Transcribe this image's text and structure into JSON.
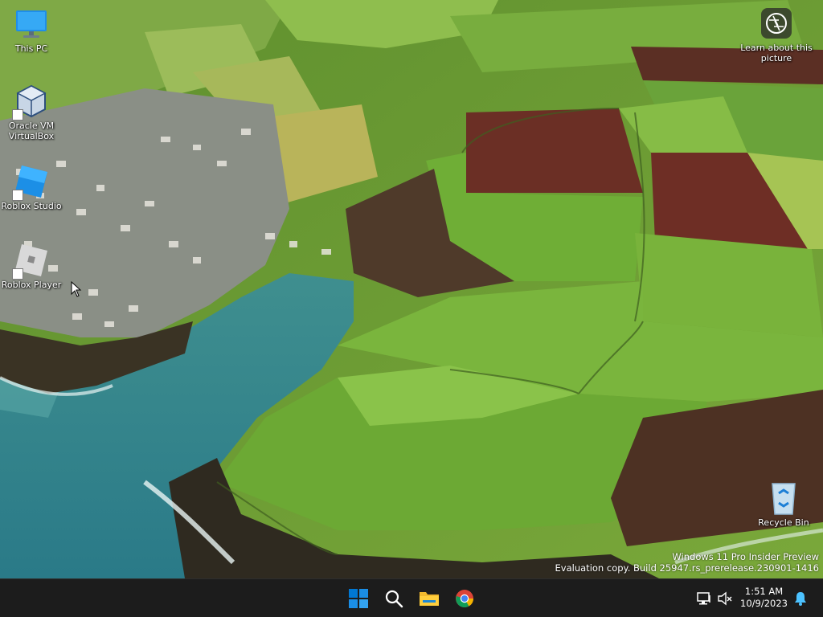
{
  "desktop": {
    "icons": [
      {
        "label": "This PC",
        "icon": "monitor-icon"
      },
      {
        "label": "Oracle VM VirtualBox",
        "icon": "virtualbox-icon"
      },
      {
        "label": "Roblox Studio",
        "icon": "roblox-studio-icon"
      },
      {
        "label": "Roblox Player",
        "icon": "roblox-player-icon"
      },
      {
        "label": "Recycle Bin",
        "icon": "recycle-bin-icon"
      }
    ],
    "learn_more": {
      "label": "Learn about this picture",
      "icon": "camera-icon"
    },
    "watermark": {
      "line1": "Windows 11 Pro Insider Preview",
      "line2": "Evaluation copy. Build 25947.rs_prerelease.230901-1416"
    }
  },
  "taskbar": {
    "pinned": [
      {
        "name": "Start",
        "icon": "windows-logo-icon"
      },
      {
        "name": "Search",
        "icon": "search-icon"
      },
      {
        "name": "File Explorer",
        "icon": "folder-icon"
      },
      {
        "name": "Google Chrome",
        "icon": "chrome-icon"
      }
    ],
    "tray": {
      "time": "1:51 AM",
      "date": "10/9/2023",
      "icons": [
        "network-icon",
        "volume-muted-icon",
        "notification-bell-icon"
      ]
    }
  },
  "colors": {
    "taskbar": "#1c1c1c",
    "accent": "#0078d4",
    "bell": "#4cc2ff"
  }
}
